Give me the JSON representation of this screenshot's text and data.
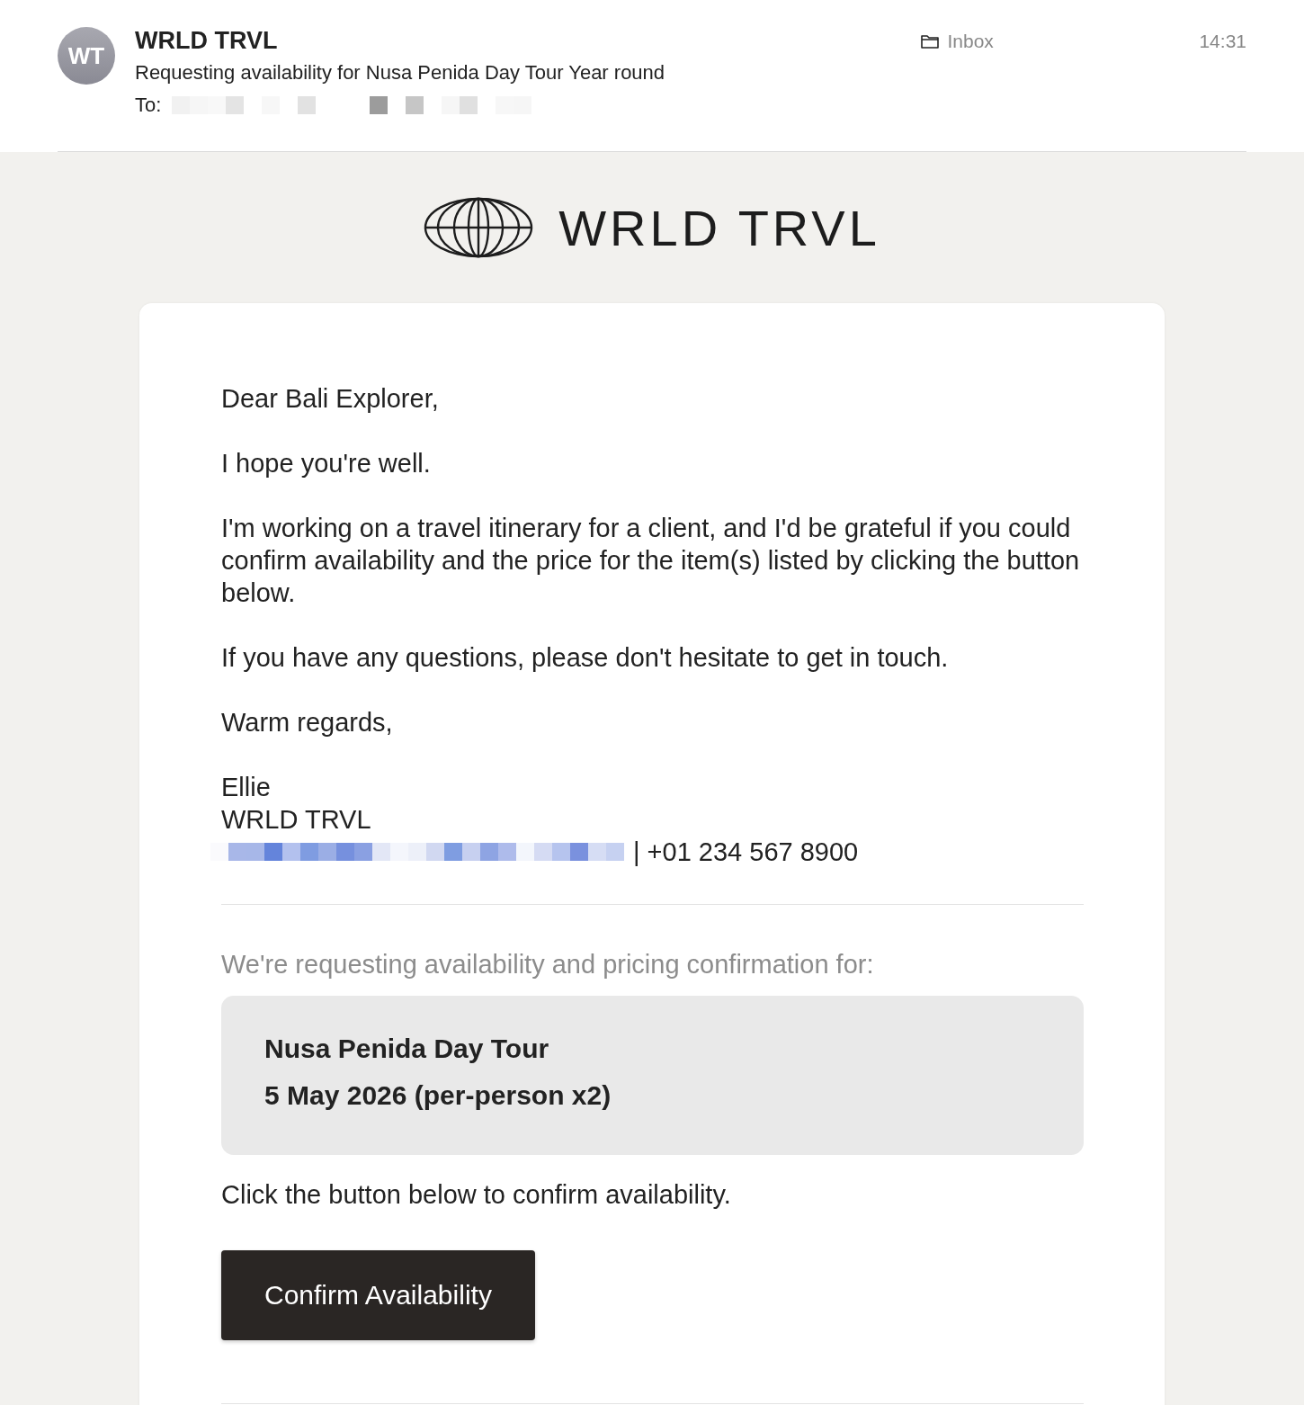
{
  "header": {
    "avatar": "WT",
    "sender": "WRLD TRVL",
    "subject": "Requesting availability for Nusa Penida Day Tour Year round",
    "to_label": "To:",
    "recipient": {
      "kind": "redacted"
    },
    "folder": "Inbox",
    "time": "14:31"
  },
  "logo": {
    "text": "WRLD TRVL"
  },
  "body": {
    "paragraphs": [
      "Dear Bali Explorer,",
      "I hope you're well.",
      "I'm working on a travel itinerary for a client, and I'd be grateful if you could confirm availability and the price for the item(s) listed by clicking the button below.",
      "If you have any questions, please don't hesitate to get in touch.",
      "Warm regards,"
    ],
    "signature": {
      "name": "Ellie",
      "company": "WRLD TRVL",
      "email": {
        "kind": "redacted"
      },
      "phone": "| +01 234 567 8900"
    }
  },
  "request": {
    "intro": "We're requesting availability and pricing confirmation for:",
    "items": [
      "Nusa Penida Day Tour",
      "5 May 2026 (per-person x2)"
    ],
    "note": "Click the button below to confirm availability.",
    "button": "Confirm Availability"
  }
}
